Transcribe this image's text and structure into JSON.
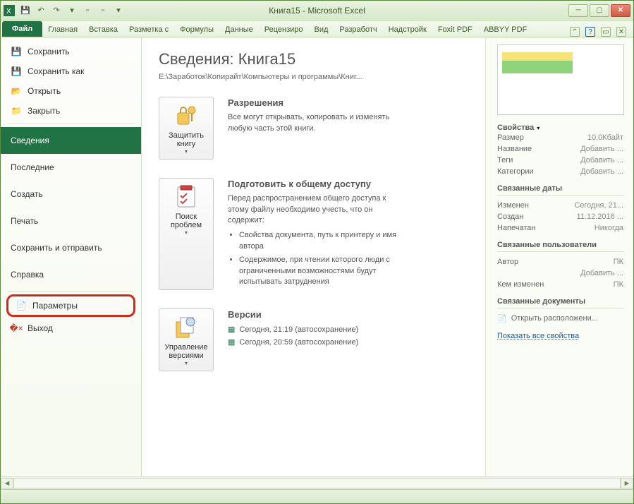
{
  "title": "Книга15  -  Microsoft Excel",
  "qat": {
    "save": "💾",
    "undo": "↶",
    "redo": "↷"
  },
  "tabs": {
    "file": "Файл",
    "items": [
      "Главная",
      "Вставка",
      "Разметка с",
      "Формулы",
      "Данные",
      "Рецензиро",
      "Вид",
      "Разработч",
      "Надстройк",
      "Foxit PDF",
      "ABBYY PDF"
    ]
  },
  "sidebar": {
    "save": "Сохранить",
    "saveAs": "Сохранить как",
    "open": "Открыть",
    "close": "Закрыть",
    "info": "Сведения",
    "recent": "Последние",
    "new": "Создать",
    "print": "Печать",
    "saveSend": "Сохранить и отправить",
    "help": "Справка",
    "options": "Параметры",
    "exit": "Выход"
  },
  "main": {
    "heading": "Сведения: Книга15",
    "path": "E:\\Заработок\\Копирайт\\Компьютеры и программы\\Книг...",
    "protect": {
      "btn": "Защитить книгу",
      "title": "Разрешения",
      "desc": "Все могут открывать, копировать и изменять любую часть этой книги."
    },
    "check": {
      "btn": "Поиск проблем",
      "title": "Подготовить к общему доступу",
      "desc": "Перед распространением общего доступа к этому файлу необходимо учесть, что он содержит:",
      "li1": "Свойства документа, путь к принтеру и имя автора",
      "li2": "Содержимое, при чтении которого люди с ограниченными возможностями будут испытывать затруднения"
    },
    "versions": {
      "btn": "Управление версиями",
      "title": "Версии",
      "v1": "Сегодня, 21:19 (автосохранение)",
      "v2": "Сегодня, 20:59 (автосохранение)"
    }
  },
  "props": {
    "header": "Свойства",
    "size_l": "Размер",
    "size_v": "10,0Кбайт",
    "title_l": "Название",
    "title_v": "Добавить ...",
    "tags_l": "Теги",
    "tags_v": "Добавить ...",
    "cat_l": "Категории",
    "cat_v": "Добавить ...",
    "dates_h": "Связанные даты",
    "mod_l": "Изменен",
    "mod_v": "Сегодня, 21...",
    "created_l": "Создан",
    "created_v": "11.12.2016 ...",
    "printed_l": "Напечатан",
    "printed_v": "Никогда",
    "users_h": "Связанные пользователи",
    "author_l": "Автор",
    "author_v": "ПК",
    "author_add": "Добавить ...",
    "modby_l": "Кем изменен",
    "modby_v": "ПК",
    "docs_h": "Связанные документы",
    "openloc": "Открыть расположени...",
    "showall": "Показать все свойства"
  }
}
